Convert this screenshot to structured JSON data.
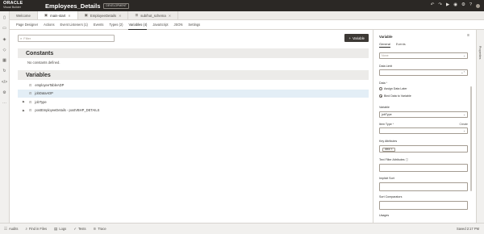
{
  "header": {
    "brand_line1": "ORACLE",
    "brand_line2": "Visual Builder",
    "app_title": "Employees_Details",
    "env_badge": "DEVELOPMENT",
    "share_label": "Share",
    "icons": [
      "undo-icon",
      "redo-icon",
      "run-icon",
      "bell-icon",
      "gear-icon",
      "help-icon",
      "user-avatar"
    ]
  },
  "left_rail": {
    "icons": [
      "mobile-apps-icon",
      "web-apps-icon",
      "services-icon",
      "business-objects-icon",
      "components-icon",
      "processes-icon",
      "source-icon",
      "settings-icon",
      "more-icon"
    ]
  },
  "file_tabs": [
    {
      "label": "Welcome",
      "active": false,
      "closable": false
    },
    {
      "label": "main-start",
      "active": true,
      "closable": true
    },
    {
      "label": "EmployeeDetails",
      "active": false,
      "closable": true
    },
    {
      "label": "sub/hot_schema",
      "active": false,
      "closable": true
    }
  ],
  "sub_tabs": [
    {
      "label": "Page Designer",
      "active": false
    },
    {
      "label": "Actions",
      "active": false
    },
    {
      "label": "Event Listeners (1)",
      "active": false
    },
    {
      "label": "Events",
      "active": false
    },
    {
      "label": "Types (2)",
      "active": false
    },
    {
      "label": "Variables (4)",
      "active": true
    },
    {
      "label": "JavaScript",
      "active": false
    },
    {
      "label": "JSON",
      "active": false
    },
    {
      "label": "Settings",
      "active": false
    }
  ],
  "main": {
    "search_placeholder": "Filter",
    "add_button": "Variable",
    "constants_title": "Constants",
    "constants_empty": "No constants defined.",
    "variables_title": "Variables",
    "variables": [
      {
        "name": "employeeTableADP",
        "expandable": false,
        "selected": false
      },
      {
        "name": "jobDataADP",
        "expandable": false,
        "selected": true
      },
      {
        "name": "jobType",
        "expandable": true,
        "selected": false
      },
      {
        "name": "postEmployeeDetails - postVBHP_DETAILS",
        "expandable": true,
        "selected": false
      }
    ]
  },
  "panel": {
    "title": "Variable",
    "tabs": [
      {
        "label": "General",
        "active": true
      },
      {
        "label": "Events",
        "active": false
      }
    ],
    "top_field_placeholder": "None",
    "data_limit_label": "Data Limit",
    "data_label": "Data",
    "radio_assign": "Assign Data Later",
    "radio_bind": "Bind Data to Variable",
    "variable_label": "Variable",
    "variable_value": "jobType",
    "item_type_label": "Item Type",
    "create_link": "Create",
    "key_attributes_label": "Key Attributes",
    "key_chip": "view",
    "text_filter_label": "Text Filter Attributes",
    "implicit_sort_label": "Implicit Sort",
    "sort_comparators_label": "Sort Comparators",
    "usages_label": "Usages"
  },
  "right_rail": {
    "label": "Properties"
  },
  "bottom_bar": {
    "items": [
      {
        "label": "Audits",
        "icon": "audits-icon"
      },
      {
        "label": "Find in Files",
        "icon": "search-icon"
      },
      {
        "label": "Logs",
        "icon": "logs-icon"
      },
      {
        "label": "Tests",
        "icon": "tests-icon"
      },
      {
        "label": "Trace",
        "icon": "trace-icon"
      }
    ],
    "saved_text": "Saved 2:17 PM"
  }
}
